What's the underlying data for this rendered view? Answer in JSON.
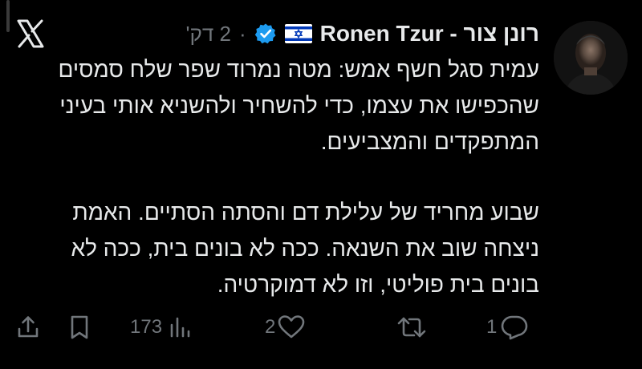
{
  "header": {
    "author_name": "Ronen Tzur - רונן צור",
    "timestamp": "2 דק'",
    "meta_separator": "·",
    "flag_icon": "israel-flag-icon",
    "verified_icon": "verified-badge-icon",
    "brand_icon": "x-logo-icon"
  },
  "tweet": {
    "paragraphs": [
      "עמית סגל חשף אמש: מטה נמרוד שפר שלח סמסים שהכפישו את עצמו, כדי להשחיר ולהשניא אותי בעיני המתפקדים והמצביעים.",
      "שבוע מחריד של עלילת דם והסתה הסתיים. האמת ניצחה שוב את השנאה. ככה לא בונים בית, ככה לא בונים בית פוליטי, וזו לא דמוקרטיה."
    ]
  },
  "actions": {
    "share_icon": "share-icon",
    "bookmark_icon": "bookmark-icon",
    "views_icon": "views-icon",
    "views_count": "173",
    "like_icon": "heart-icon",
    "likes_count": "2",
    "retweet_icon": "retweet-icon",
    "reply_icon": "reply-icon",
    "replies_count": "1"
  },
  "colors": {
    "background": "#000000",
    "text": "#e7e9ea",
    "muted": "#71767b",
    "verified": "#1d9bf0",
    "flag_blue": "#0038b8"
  }
}
